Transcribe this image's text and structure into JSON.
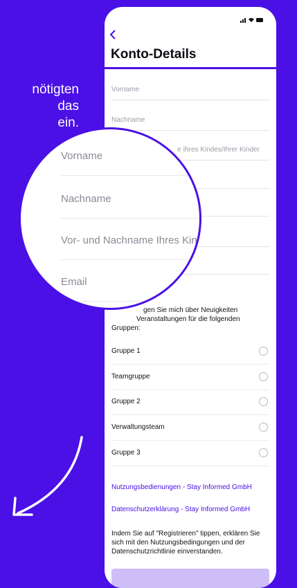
{
  "promo": {
    "line1": "nötigten",
    "line2": "das",
    "line3": "ein."
  },
  "header": {
    "title": "Konto-Details"
  },
  "fields": {
    "first_name": "Vorname",
    "last_name": "Nachname",
    "children_partial": "e Ihres Kindes/Ihrer Kinder"
  },
  "notify": {
    "line1": "gen Sie mich über Neuigkeiten",
    "line2": "Veranstaltungen für die folgenden",
    "line3": "Gruppen:"
  },
  "groups": [
    "Gruppe 1",
    "Teamgruppe",
    "Gruppe 2",
    "Verwaltungsteam",
    "Gruppe 3"
  ],
  "links": {
    "terms": "Nutzungsbedienungen - Stay Informed GmbH",
    "privacy": "Datenschutzerklärung - Stay Informed GmbH"
  },
  "consent": {
    "line1": "Indem Sie auf \"Registrieren\" tippen, erklären Sie",
    "line2": "sich mit den Nutzungsbedingungen und der",
    "line3": "Datenschutzrichtlinie einverstanden."
  },
  "magnifier": {
    "first_name": "Vorname",
    "last_name": "Nachname",
    "children_name": "Vor- und Nachname Ihres Kin",
    "email": "Email"
  },
  "colors": {
    "brand": "#4B10E6",
    "text": "#111111",
    "muted": "#9a9aa6"
  }
}
